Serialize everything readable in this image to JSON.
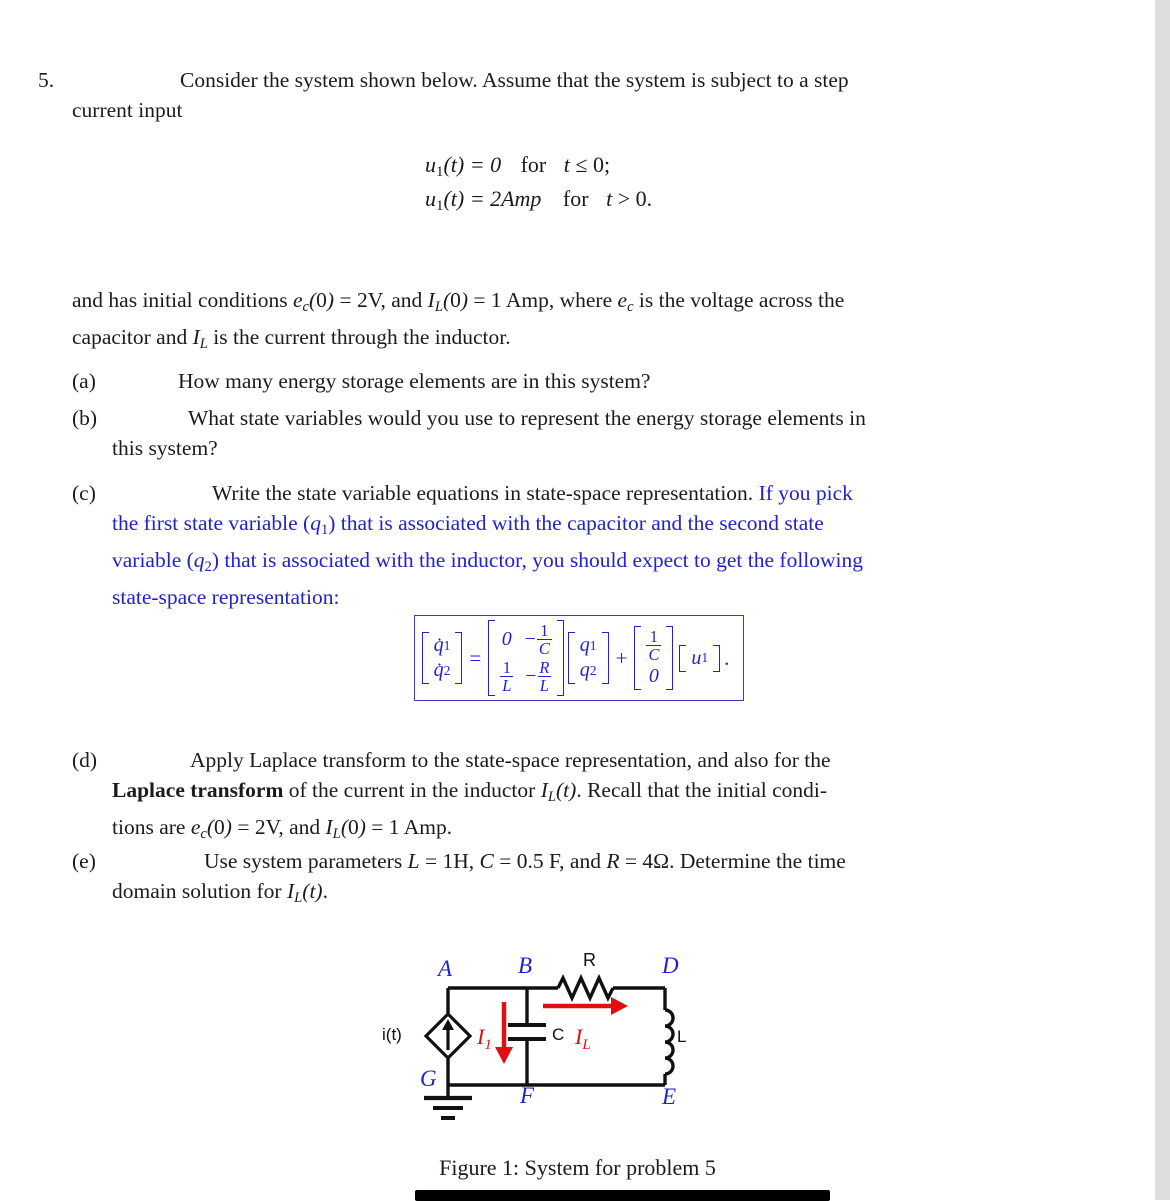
{
  "document": {
    "problem_number": "5.",
    "intro": "Consider the system shown below.  Assume that the system is subject to a step current input",
    "equation_line_1": "u₁(t) = 0   for   t ≤ 0;",
    "equation_line_2": "u₁(t) = 2Amp    for   t > 0.",
    "initial_conditions": "and has initial conditions e₌(0) = 2V, and Iₗ(0) = 1 Amp, where e₌ is the voltage across the capacitor and Iₗ is the current through the inductor.",
    "caption": "Figure 1: System for problem 5"
  },
  "items": [
    {
      "label": "(a)",
      "text": "How many energy storage elements are in this system?"
    },
    {
      "label": "(b)",
      "text": "What state variables would you use to represent the energy storage elements in this system?"
    },
    {
      "label": "(c)",
      "text_black": "Write the state variable equations in state-space representation.",
      "text_blue": "If you pick the first state variable (q₁) that is associated with the capacitor and the second state variable (q₂) that is associated with the inductor, you should expect to get the following state-space representation:"
    },
    {
      "label": "(d)",
      "text": "Apply Laplace transform to the state-space representation, and also for the Laplace transform of the current in the inductor Iₗ(t). Recall that the initial conditions are e₌(0) = 2V, and Iₗ(0) = 1 Amp.",
      "bold_fragment": "Laplace transform"
    },
    {
      "label": "(e)",
      "text": "Use system parameters L = 1H, C = 0.5 F, and R = 4Ω. Determine the time domain solution for Iₗ(t)."
    }
  ],
  "state_space": {
    "lhs": {
      "rows": [
        "q̇₁",
        "q̇₂"
      ]
    },
    "equals": "=",
    "A": {
      "rows": [
        [
          "0",
          "−1/C"
        ],
        [
          "1/L",
          "−R/L"
        ]
      ]
    },
    "x": {
      "rows": [
        "q₁",
        "q₂"
      ]
    },
    "plus": "+",
    "B": {
      "rows": [
        "1/C",
        "0"
      ]
    },
    "u": {
      "rows": [
        "u₁"
      ]
    },
    "period": ".",
    "color": "#2222cc"
  },
  "circuit": {
    "nodes": {
      "A": "A",
      "B": "B",
      "D": "D",
      "E": "E",
      "F": "F",
      "G": "G"
    },
    "components": {
      "source": "i(t)",
      "capacitor": "C",
      "resistor": "R",
      "inductor": "L"
    },
    "currents": {
      "capacitor_branch": "I₁",
      "inductor_branch": "Iₗ"
    },
    "colors": {
      "node_label": "#2222cc",
      "current_label": "#e01010",
      "wire": "#101010"
    }
  },
  "text_fragments": {
    "intro_part1": "Consider the system shown below.  Assume that the system is subject to a step",
    "intro_part2": "current input",
    "ic_part1": "and has initial conditions ",
    "ic_part2": " is the voltage across the",
    "ic_part3": "capacitor and ",
    "ic_part4": " is the current through the inductor.",
    "d_part1": "Apply Laplace transform to the state-space representation, and also for the",
    "d_part2": " of the current in the inductor ",
    "d_part3": ". Recall that the initial condi-",
    "d_part4": "tions are ",
    "e_part1": "Use system parameters ",
    "e_part2": ". Determine the time",
    "e_part3": "domain solution for ",
    "c_black": "Write the state variable equations in state-space representation.",
    "c_blue_1": "If you pick",
    "c_blue_2": "the first state variable (q₁) that is associated with the capacitor and the second state",
    "c_blue_3": "variable (q₂) that is associated with the inductor, you should expect to get the following",
    "c_blue_4": "state-space representation:",
    "a_text": "How many energy storage elements are in this system?",
    "b_text_1": "What state variables would you use to represent the energy storage elements in",
    "b_text_2": "this system?"
  }
}
